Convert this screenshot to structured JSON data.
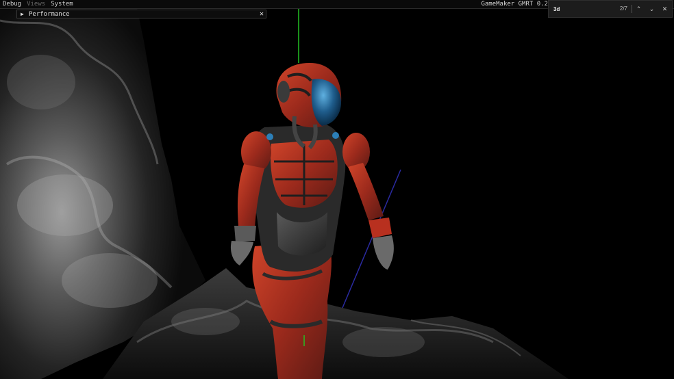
{
  "menubar": {
    "debug": "Debug",
    "views": "Views",
    "system": "System",
    "runtime": "GameMaker GMRT 0.2"
  },
  "perf_panel": {
    "collapse_glyph": "▶",
    "title": "Performance",
    "close_glyph": "✕"
  },
  "find_bar": {
    "query": "3d",
    "count": "2/7",
    "prev_glyph": "⌃",
    "next_glyph": "⌄",
    "close_glyph": "✕"
  },
  "scene": {
    "description_icons": [
      "rock-terrain",
      "armored-character",
      "axis-gizmo"
    ],
    "colors": {
      "background": "#000000",
      "armor_red": "#b8301f",
      "visor": "#1f5d8c",
      "rock": "#8a8a8a",
      "axis_green": "#22c022",
      "axis_blue": "#2a2aa0"
    }
  }
}
